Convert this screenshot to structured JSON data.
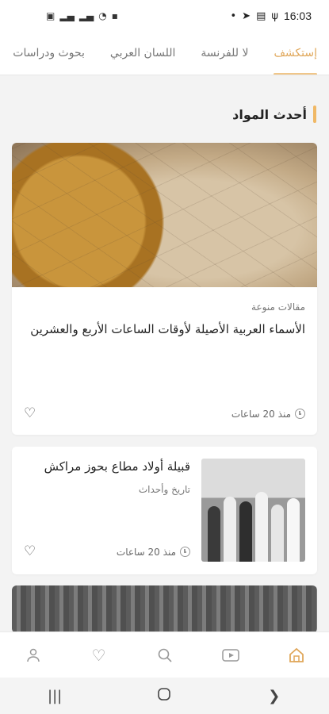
{
  "status_bar": {
    "time": "16:03",
    "left_icons": [
      "sim-icon",
      "signal-icon",
      "signal-icon",
      "wifi-icon",
      "battery-saver-icon"
    ],
    "right_icons": [
      "dot-icon",
      "telegram-icon",
      "gallery-icon",
      "usb-icon"
    ]
  },
  "tabs": [
    {
      "label": "إستكشف",
      "active": true
    },
    {
      "label": "لا للفرنسة",
      "active": false
    },
    {
      "label": "اللسان العربي",
      "active": false
    },
    {
      "label": "بحوث ودراسات",
      "active": false
    }
  ],
  "section": {
    "title": "أحدث المواد"
  },
  "articles": [
    {
      "category": "مقالات منوعة",
      "title": "الأسماء العربية الأصيلة لأوقات الساعات الأربع والعشرين",
      "time": "منذ 20 ساعات"
    },
    {
      "title": "قبيلة أولاد مطاع بحوز مراكش",
      "category": "تاريخ وأحداث",
      "time": "منذ 20 ساعات"
    }
  ],
  "bottom_nav": [
    "home-icon",
    "video-icon",
    "search-icon",
    "heart-icon",
    "profile-icon"
  ],
  "colors": {
    "accent": "#e0a75a",
    "background": "#f3f3f3"
  }
}
